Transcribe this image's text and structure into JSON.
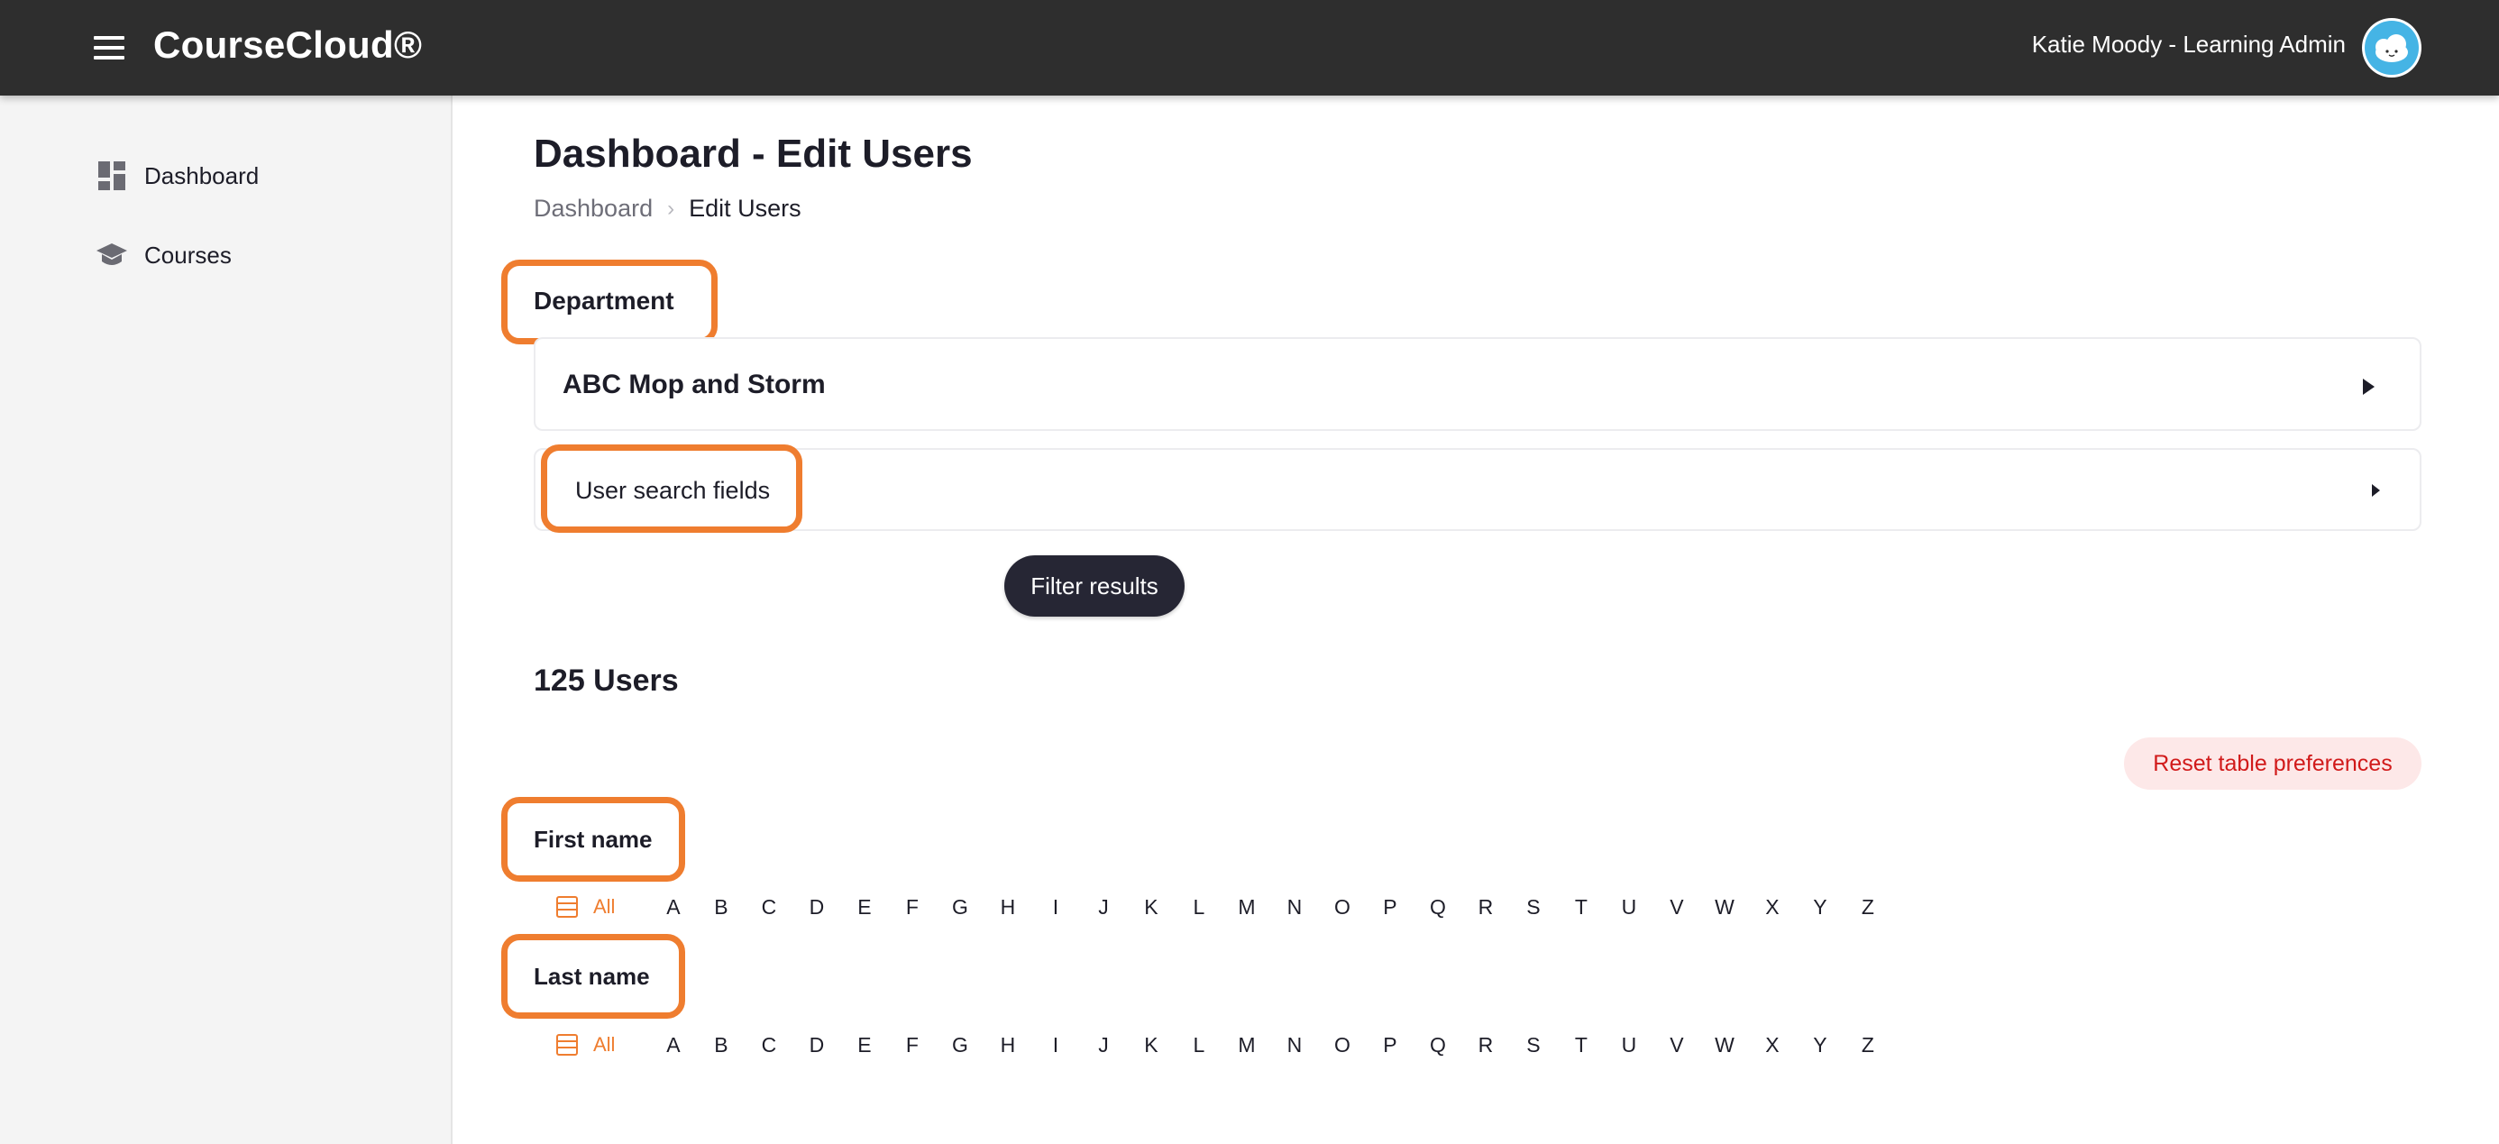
{
  "header": {
    "brand": "CourseCloud®",
    "user_label": "Katie Moody - Learning Admin"
  },
  "sidebar": {
    "items": [
      {
        "label": "Dashboard",
        "icon": "dashboard-icon"
      },
      {
        "label": "Courses",
        "icon": "graduation-cap-icon"
      }
    ]
  },
  "main": {
    "page_title": "Dashboard - Edit Users",
    "breadcrumb": {
      "parent": "Dashboard",
      "current": "Edit Users"
    },
    "department_label": "Department",
    "department_card_title": "ABC Mop and Storm",
    "search_card_title": "User search fields",
    "filter_button": "Filter results",
    "users_count": "125 Users",
    "reset_button": "Reset table preferences",
    "first_name_label": "First name",
    "last_name_label": "Last name",
    "all_label": "All",
    "letters": [
      "A",
      "B",
      "C",
      "D",
      "E",
      "F",
      "G",
      "H",
      "I",
      "J",
      "K",
      "L",
      "M",
      "N",
      "O",
      "P",
      "Q",
      "R",
      "S",
      "T",
      "U",
      "V",
      "W",
      "X",
      "Y",
      "Z"
    ]
  },
  "colors": {
    "highlight": "#ef7d2f",
    "topbar": "#2e2e2e",
    "reset_text": "#d11a1a"
  }
}
